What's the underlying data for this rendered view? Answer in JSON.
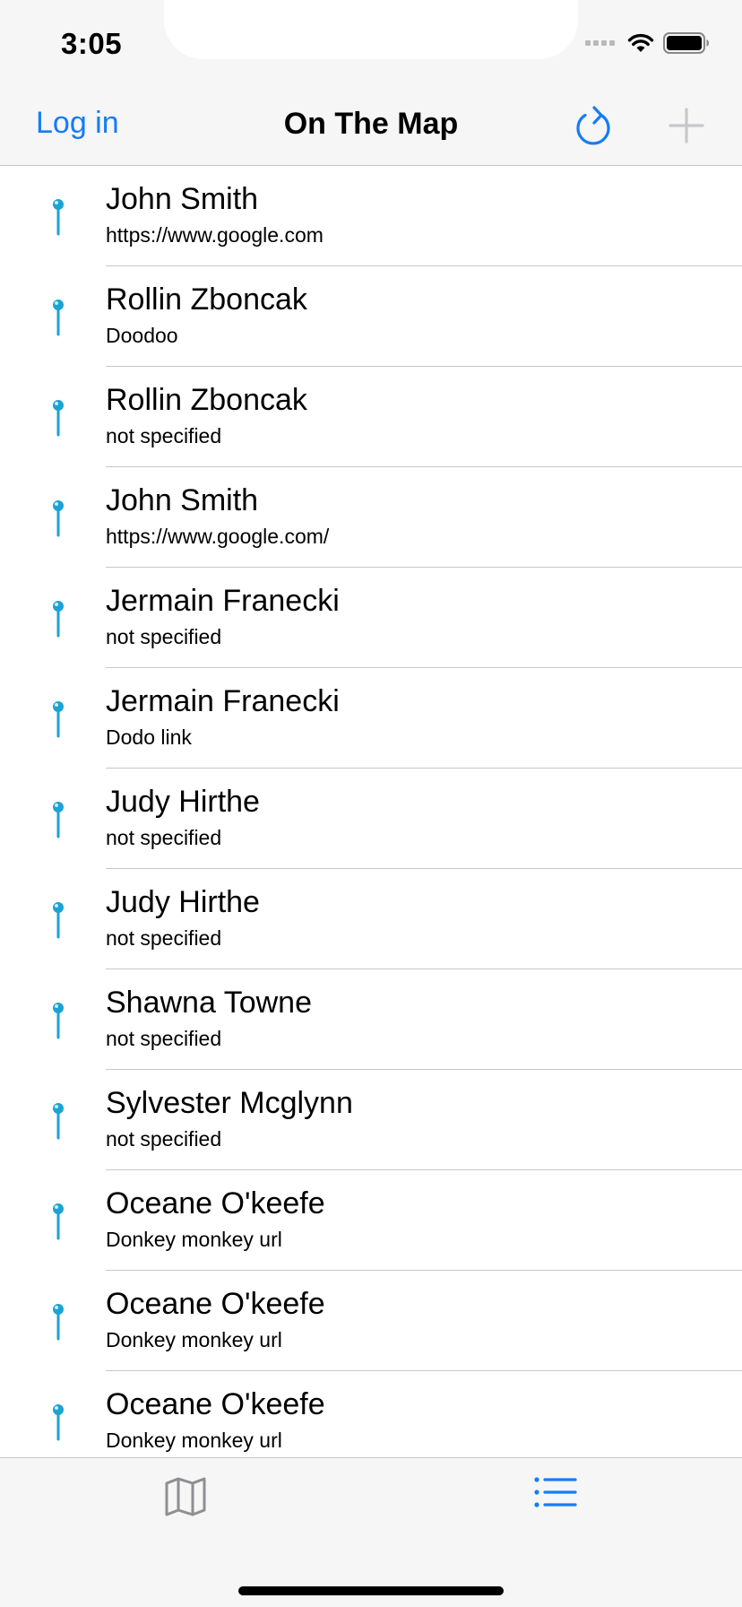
{
  "status_bar": {
    "time": "3:05"
  },
  "nav_bar": {
    "login_label": "Log in",
    "title": "On The Map",
    "refresh_icon": "refresh-icon",
    "add_icon": "plus-icon"
  },
  "list": {
    "items": [
      {
        "name": "John Smith",
        "link": "https://www.google.com"
      },
      {
        "name": "Rollin Zboncak",
        "link": "Doodoo"
      },
      {
        "name": "Rollin Zboncak",
        "link": "not specified"
      },
      {
        "name": "John Smith",
        "link": "https://www.google.com/"
      },
      {
        "name": "Jermain Franecki",
        "link": "not specified"
      },
      {
        "name": "Jermain Franecki",
        "link": "Dodo link"
      },
      {
        "name": "Judy Hirthe",
        "link": "not specified"
      },
      {
        "name": "Judy Hirthe",
        "link": "not specified"
      },
      {
        "name": "Shawna Towne",
        "link": "not specified"
      },
      {
        "name": "Sylvester Mcglynn",
        "link": "not specified"
      },
      {
        "name": "Oceane O'keefe",
        "link": "Donkey monkey url"
      },
      {
        "name": "Oceane O'keefe",
        "link": "Donkey monkey url"
      },
      {
        "name": "Oceane O'keefe",
        "link": "Donkey monkey url"
      }
    ]
  },
  "tab_bar": {
    "tabs": [
      {
        "icon": "map-icon",
        "selected": false
      },
      {
        "icon": "list-icon",
        "selected": true
      }
    ]
  },
  "colors": {
    "accent": "#157cf7",
    "pin": "#1aa3d4",
    "inactive": "#8e8e93",
    "disabled": "#c7c7cc"
  }
}
